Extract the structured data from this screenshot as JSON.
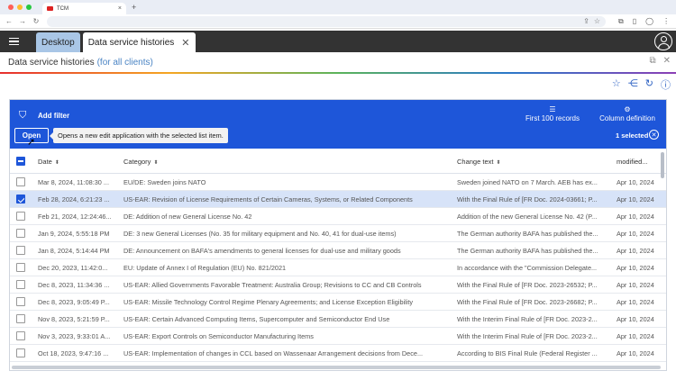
{
  "browser": {
    "tab_title": "TCM",
    "traffic_colors": [
      "#ff5f57",
      "#febc2e",
      "#28c840"
    ]
  },
  "app": {
    "tabs": [
      {
        "label": "Desktop"
      },
      {
        "label": "Data service histories"
      }
    ]
  },
  "page": {
    "title": "Data service histories",
    "subtitle": "(for all clients)"
  },
  "toolbar": {
    "add_filter": "Add filter",
    "first_records": "First 100 records",
    "column_definition": "Column definition",
    "open_label": "Open",
    "tooltip": "Opens a new edit application with the selected list item.",
    "selected_count": "1 selected"
  },
  "table": {
    "headers": {
      "date": "Date",
      "category": "Category",
      "change_text": "Change text",
      "modified": "modified..."
    },
    "rows": [
      {
        "date": "Mar 8, 2024, 11:08:30 ...",
        "category": "EU/DE: Sweden joins NATO",
        "change_text": "Sweden joined NATO on 7 March. AEB has ex...",
        "modified": "Apr 10, 2024",
        "selected": false
      },
      {
        "date": "Feb 28, 2024, 6:21:23 ...",
        "category": "US-EAR: Revision of License Requirements of Certain Cameras, Systems, or Related Components",
        "change_text": "With the Final Rule of [FR Doc. 2024-03661; P...",
        "modified": "Apr 10, 2024",
        "selected": true
      },
      {
        "date": "Feb 21, 2024, 12:24:46...",
        "category": "DE: Addition of new General License No. 42",
        "change_text": "Addition of the new General License No. 42 (P...",
        "modified": "Apr 10, 2024",
        "selected": false
      },
      {
        "date": "Jan 9, 2024, 5:55:18 PM",
        "category": "DE: 3 new General Licenses (No. 35 for military equipment and No. 40, 41 for dual-use items)",
        "change_text": "The German authority BAFA has published the...",
        "modified": "Apr 10, 2024",
        "selected": false
      },
      {
        "date": "Jan 8, 2024, 5:14:44 PM",
        "category": "DE: Announcement on BAFA's amendments to general licenses for dual-use and military goods",
        "change_text": "The German authority BAFA has published the...",
        "modified": "Apr 10, 2024",
        "selected": false
      },
      {
        "date": "Dec 20, 2023, 11:42:0...",
        "category": "EU: Update of Annex I of Regulation (EU) No. 821/2021",
        "change_text": "In accordance with the \"Commission Delegate...",
        "modified": "Apr 10, 2024",
        "selected": false
      },
      {
        "date": "Dec 8, 2023, 11:34:36 ...",
        "category": "US-EAR: Allied Governments Favorable Treatment: Australia Group; Revisions to CC and CB Controls",
        "change_text": "With the Final Rule of [FR Doc. 2023-26532; P...",
        "modified": "Apr 10, 2024",
        "selected": false
      },
      {
        "date": "Dec 8, 2023, 9:05:49 P...",
        "category": "US-EAR: Missile Technology Control Regime Plenary Agreements; and License Exception Eligibility",
        "change_text": "With the Final Rule of [FR Doc. 2023-26682; P...",
        "modified": "Apr 10, 2024",
        "selected": false
      },
      {
        "date": "Nov 8, 2023, 5:21:59 P...",
        "category": "US-EAR: Certain Advanced Computing Items, Supercomputer and Semiconductor End Use",
        "change_text": "With the Interim Final Rule of [FR Doc. 2023-2...",
        "modified": "Apr 10, 2024",
        "selected": false
      },
      {
        "date": "Nov 3, 2023, 9:33:01 A...",
        "category": "US-EAR: Export Controls on Semiconductor Manufacturing Items",
        "change_text": "With the Interim Final Rule of [FR Doc. 2023-2...",
        "modified": "Apr 10, 2024",
        "selected": false
      },
      {
        "date": "Oct 18, 2023, 9:47:16 ...",
        "category": "US-EAR: Implementation of changes in CCL based on Wassenaar Arrangement decisions from Dece...",
        "change_text": "According to BIS Final Rule (Federal Register ...",
        "modified": "Apr 10, 2024",
        "selected": false
      }
    ]
  }
}
